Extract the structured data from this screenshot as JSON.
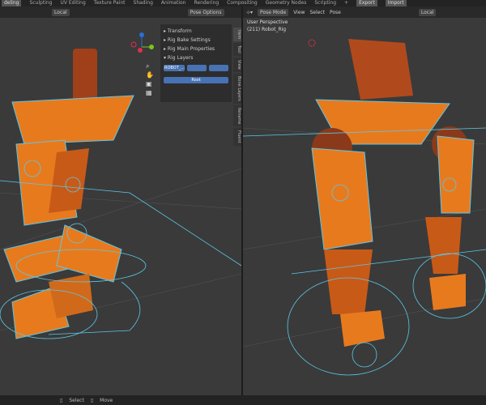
{
  "topbar": {
    "tabs": [
      "deling",
      "Sculpting",
      "UV Editing",
      "Texture Paint",
      "Shading",
      "Animation",
      "Rendering",
      "Compositing",
      "Geometry Nodes",
      "Scripting",
      "+",
      "Export",
      "Import"
    ]
  },
  "left_viewport": {
    "header": {
      "orientation": "Local",
      "pose_options": "Pose Options"
    },
    "npanel": {
      "sections": [
        "Transform",
        "Rig Bake Settings",
        "Rig Main Properties",
        "Rig Layers"
      ],
      "layer_fields": [
        "ROBOT_...",
        "",
        ""
      ],
      "root_button": "Root"
    },
    "side_tabs": [
      "Item",
      "Tool",
      "View",
      "Bone Layers",
      "Rename",
      "Fluent"
    ]
  },
  "right_viewport": {
    "header": {
      "mode": "Pose Mode",
      "menus": [
        "View",
        "Select",
        "Pose"
      ],
      "orientation": "Local"
    },
    "overlay": {
      "perspective": "User Perspective",
      "object": "(211) Robot_Rig"
    }
  },
  "statusbar": {
    "items": [
      "Select",
      "Move"
    ]
  },
  "colors": {
    "orange": "#e87a1e",
    "bone": "#5bc8e8",
    "accent": "#4772b3"
  }
}
